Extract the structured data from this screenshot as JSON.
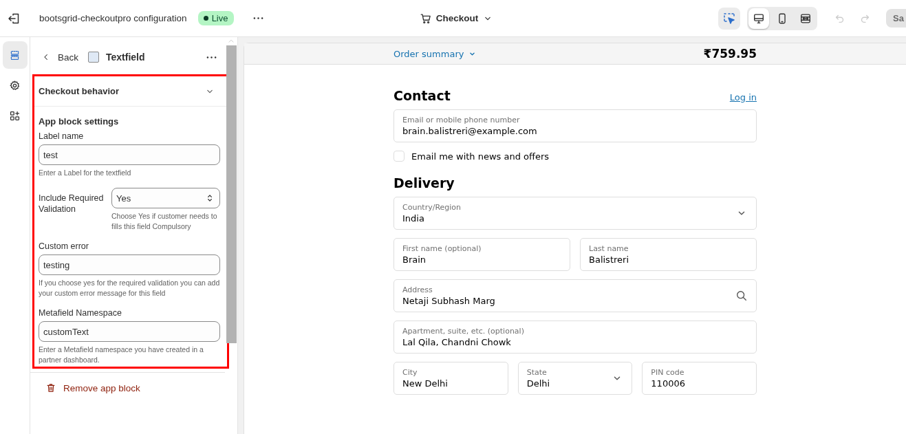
{
  "topbar": {
    "title": "bootsgrid-checkoutpro configuration",
    "status": {
      "label": "Live",
      "color": "#b4f5c4"
    },
    "page_selector": "Checkout",
    "inspector": {
      "selected": true
    },
    "view_modes": [
      {
        "kind": "desktop",
        "selected": true
      },
      {
        "kind": "mobile",
        "selected": false
      },
      {
        "kind": "fullwidth",
        "selected": false
      }
    ],
    "undo": {
      "disabled": true
    },
    "redo": {
      "disabled": true
    },
    "save": {
      "label": "Sa",
      "disabled": true
    }
  },
  "rail": {
    "items": [
      {
        "kind": "sections",
        "selected": true
      },
      {
        "kind": "settings",
        "selected": false
      },
      {
        "kind": "apps",
        "selected": false
      }
    ]
  },
  "panel": {
    "back": "Back",
    "title": "Textfield",
    "section": {
      "label": "Checkout behavior",
      "expanded": false
    },
    "heading": "App block settings",
    "fields": [
      {
        "kind": "text",
        "label": "Label name",
        "value": "test",
        "help": "Enter a Label for the textfield"
      },
      {
        "kind": "select",
        "label": "Include Required Validation",
        "value": "Yes",
        "help": "Choose Yes if customer needs to fills this field Compulsory"
      },
      {
        "kind": "text",
        "label": "Custom error",
        "value": "testing",
        "help": "If you choose yes for the required validation you can add your custom error message for this field"
      },
      {
        "kind": "text",
        "label": "Metafield Namespace",
        "value": "customText",
        "help": "Enter a Metafield namespace you have created in a partner dashboard."
      }
    ],
    "remove": "Remove app block"
  },
  "preview": {
    "order_summary": "Order summary",
    "total": "₹759.95",
    "contact": {
      "heading": "Contact",
      "login": "Log in",
      "email": {
        "label": "Email or mobile phone number",
        "value": "brain.balistreri@example.com"
      },
      "newsletter": {
        "label": "Email me with news and offers",
        "checked": false
      }
    },
    "delivery": {
      "heading": "Delivery",
      "rows": [
        [
          {
            "kind": "select",
            "label": "Country/Region",
            "value": "India"
          }
        ],
        [
          {
            "kind": "text",
            "label": "First name (optional)",
            "value": "Brain"
          },
          {
            "kind": "text",
            "label": "Last name",
            "value": "Balistreri"
          }
        ],
        [
          {
            "kind": "search",
            "label": "Address",
            "value": "Netaji Subhash Marg"
          }
        ],
        [
          {
            "kind": "text",
            "label": "Apartment, suite, etc. (optional)",
            "value": "Lal Qila, Chandni Chowk"
          }
        ],
        [
          {
            "kind": "text",
            "label": "City",
            "value": "New Delhi"
          },
          {
            "kind": "select",
            "label": "State",
            "value": "Delhi"
          },
          {
            "kind": "text",
            "label": "PIN code",
            "value": "110006"
          }
        ]
      ]
    }
  }
}
